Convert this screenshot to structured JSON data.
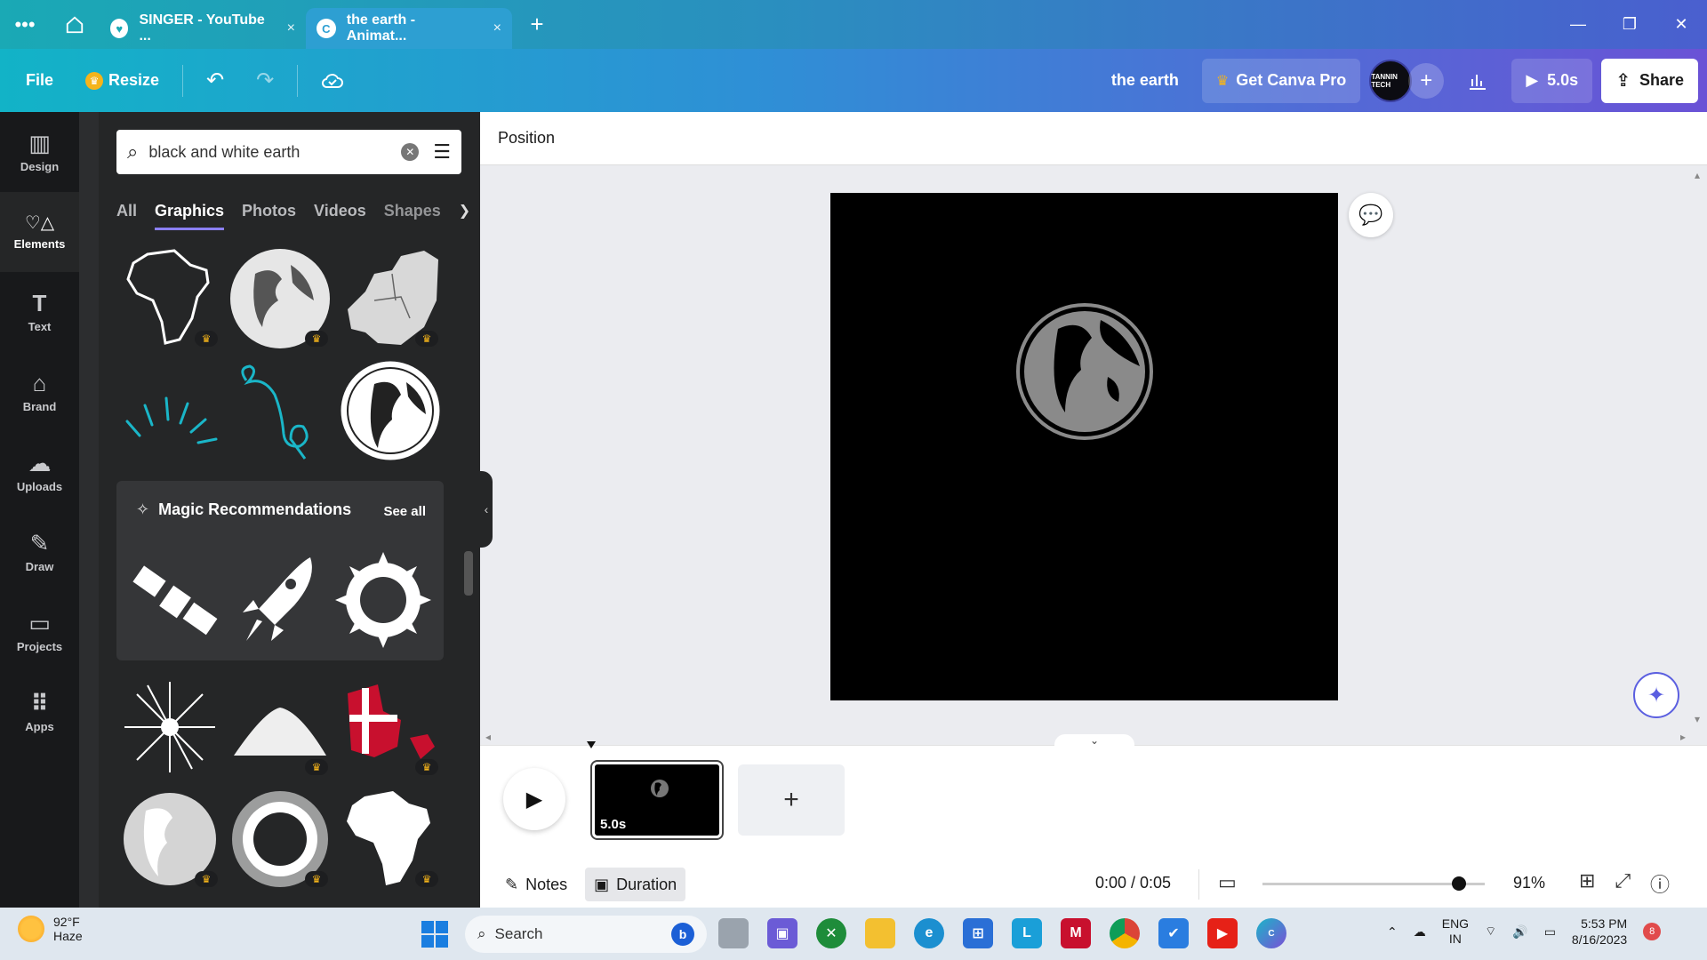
{
  "browser": {
    "tabs": [
      {
        "title": "SINGER - YouTube ...",
        "favicon": "heart-chat-icon",
        "active": false
      },
      {
        "title": "the earth - Animat...",
        "favicon": "canva-c-icon",
        "active": true
      }
    ],
    "new_tab_symbol": "+",
    "close_symbol": "×"
  },
  "toolbar": {
    "file_label": "File",
    "resize_label": "Resize",
    "doc_title": "the earth",
    "pro_label": "Get Canva Pro",
    "avatar_text": "TANNIN TECH",
    "play_duration_label": "5.0s",
    "share_label": "Share"
  },
  "rail": {
    "items": [
      {
        "label": "Design",
        "icon": "▥"
      },
      {
        "label": "Elements",
        "icon": "♡△"
      },
      {
        "label": "Text",
        "icon": "T"
      },
      {
        "label": "Brand",
        "icon": "⌂"
      },
      {
        "label": "Uploads",
        "icon": "☁"
      },
      {
        "label": "Draw",
        "icon": "✎"
      },
      {
        "label": "Projects",
        "icon": "▭"
      },
      {
        "label": "Apps",
        "icon": "⠿"
      }
    ],
    "active_index": 1
  },
  "panel": {
    "search_value": "black and white earth",
    "tabs": [
      "All",
      "Graphics",
      "Photos",
      "Videos",
      "Shapes"
    ],
    "active_tab": "Graphics",
    "magic": {
      "title": "Magic Recommendations",
      "see_all": "See all"
    }
  },
  "editor": {
    "context_label": "Position"
  },
  "timeline": {
    "page_duration": "5.0s",
    "notes_label": "Notes",
    "duration_label": "Duration",
    "time_readout": "0:00 / 0:05",
    "zoom_label": "91%",
    "zoom_fraction": 0.91
  },
  "taskbar": {
    "temperature": "92°F",
    "condition": "Haze",
    "search_label": "Search",
    "lang_1": "ENG",
    "lang_2": "IN",
    "time": "5:53 PM",
    "date": "8/16/2023",
    "notifications": "8"
  },
  "colors": {
    "accent": "#8b7ff5",
    "pro_crown": "#f5b41a",
    "panel_bg": "#252627",
    "rail_bg": "#18191b"
  }
}
